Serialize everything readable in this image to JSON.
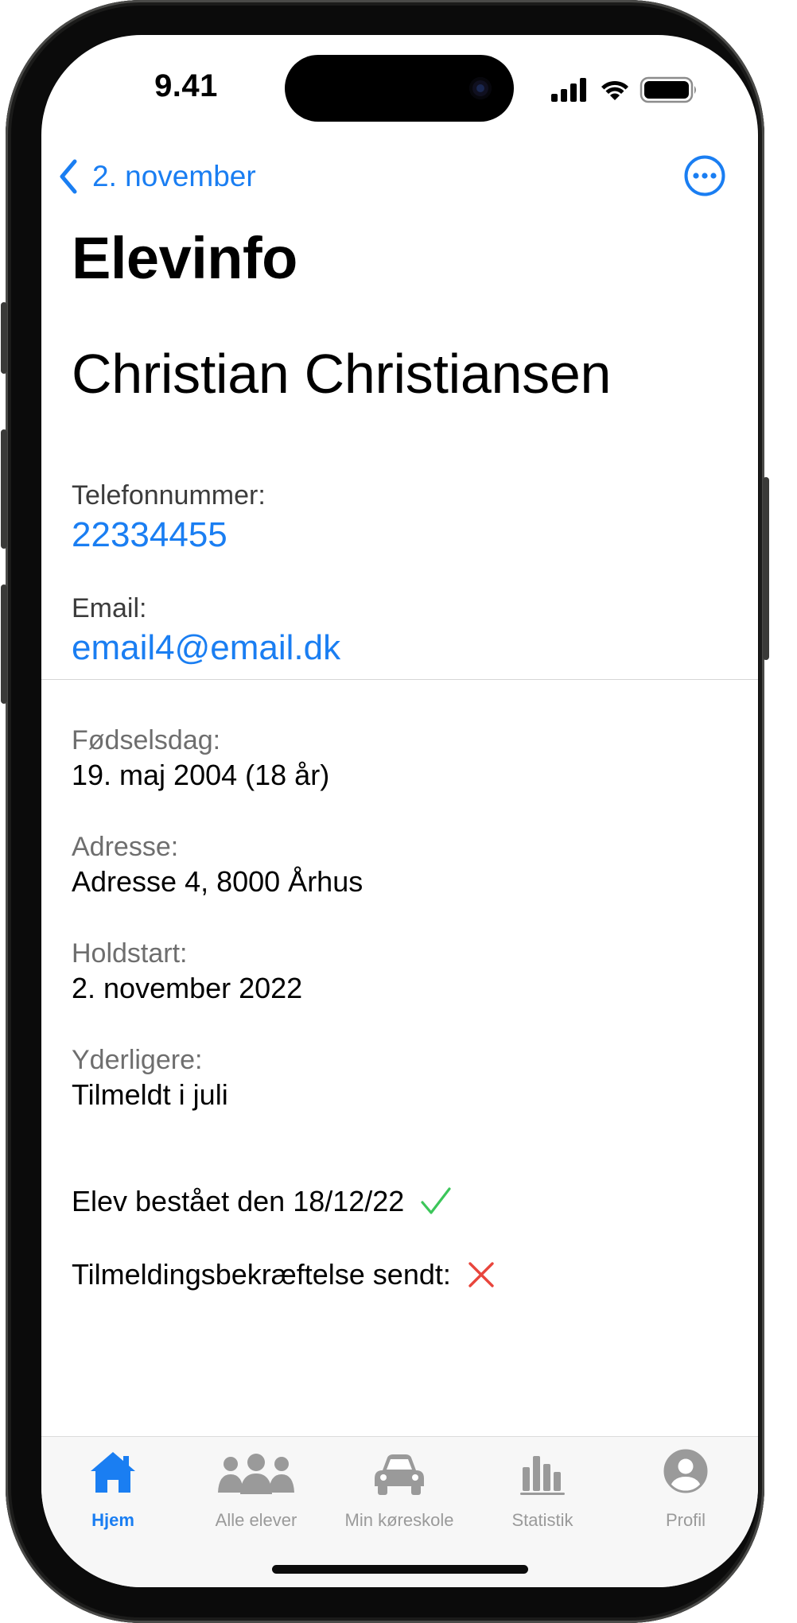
{
  "status_bar": {
    "time": "9.41"
  },
  "nav": {
    "back_label": "2. november",
    "more_icon": "ellipsis-circle-icon"
  },
  "page": {
    "title": "Elevinfo",
    "student_name": "Christian Christiansen"
  },
  "contact": {
    "phone_label": "Telefonnummer:",
    "phone_value": "22334455",
    "email_label": "Email:",
    "email_value": "email4@email.dk"
  },
  "details": {
    "birthday_label": "Fødselsdag:",
    "birthday_value": "19. maj 2004  (18 år)",
    "address_label": "Adresse:",
    "address_value": "Adresse 4, 8000 Århus",
    "start_label": "Holdstart:",
    "start_value": "2. november 2022",
    "extra_label": "Yderligere:",
    "extra_value": "Tilmeldt i juli",
    "passed_text": "Elev bestået den 18/12/22",
    "passed_status": "checkmark-icon",
    "confirmation_text": "Tilmeldingsbekræftelse sendt:",
    "confirmation_status": "x-mark-icon"
  },
  "colors": {
    "accent": "#1a7ef2",
    "success": "#3cc65a",
    "error": "#e8453c"
  },
  "tabbar": {
    "active_index": 0,
    "tabs": [
      {
        "label": "Hjem",
        "icon": "house-icon"
      },
      {
        "label": "Alle elever",
        "icon": "people-group-icon"
      },
      {
        "label": "Min køreskole",
        "icon": "car-icon"
      },
      {
        "label": "Statistik",
        "icon": "bar-chart-icon"
      },
      {
        "label": "Profil",
        "icon": "person-circle-icon"
      }
    ]
  }
}
